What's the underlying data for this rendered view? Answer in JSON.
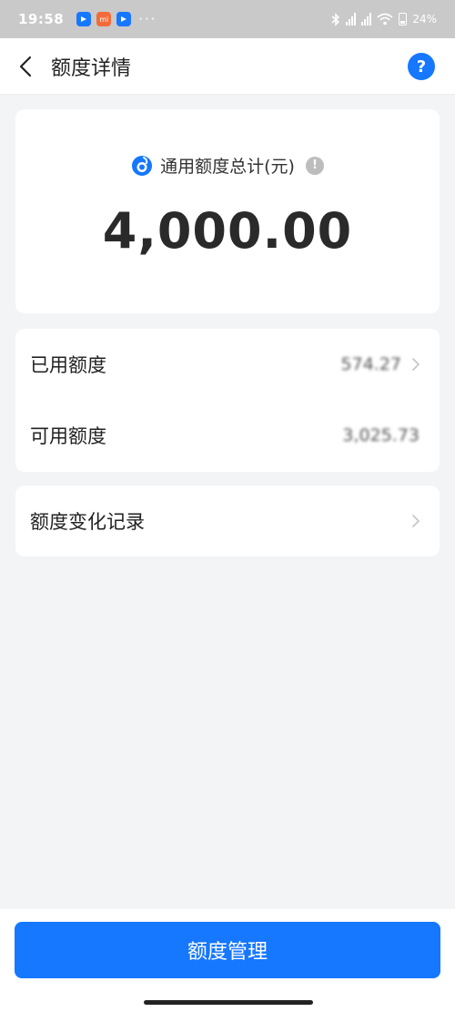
{
  "status_bar": {
    "time": "19:58",
    "app_icons": [
      {
        "name": "app-notification-icon",
        "color": "#1677ff",
        "label": ""
      },
      {
        "name": "mi-app-icon",
        "color": "#f26b3a",
        "label": "mi"
      },
      {
        "name": "app-notification-icon",
        "color": "#1677ff",
        "label": ""
      }
    ],
    "more": "···",
    "battery": "24%"
  },
  "header": {
    "title": "额度详情",
    "help_label": "?"
  },
  "summary": {
    "label": "通用额度总计(元)",
    "info_label": "!",
    "total": "4,000.00"
  },
  "credit_list": [
    {
      "label": "已用额度",
      "value": "574.27",
      "has_chevron": true
    },
    {
      "label": "可用额度",
      "value": "3,025.73",
      "has_chevron": false
    }
  ],
  "history": {
    "label": "额度变化记录"
  },
  "footer": {
    "manage_label": "额度管理"
  },
  "colors": {
    "accent": "#1677ff",
    "background": "#f3f4f6",
    "status_bar": "#c9c9c9"
  }
}
